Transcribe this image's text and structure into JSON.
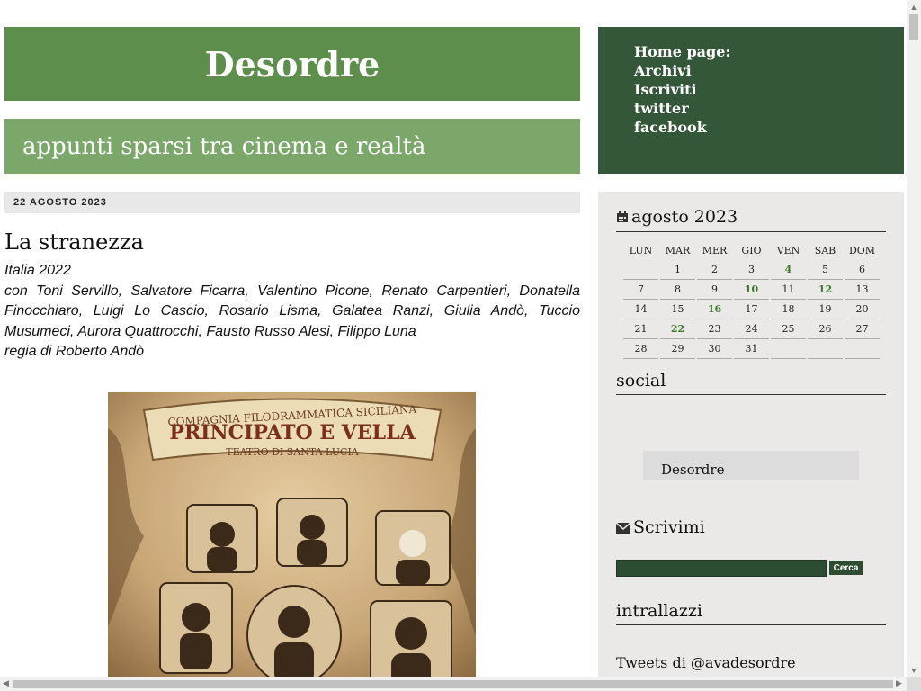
{
  "header": {
    "title": "Desordre",
    "tagline": "appunti sparsi tra cinema e realtà"
  },
  "nav": {
    "items": [
      "Home page:",
      "Archivi",
      "Iscriviti",
      "twitter",
      "facebook"
    ]
  },
  "post": {
    "date": "22 AGOSTO 2023",
    "title": "La stranezza",
    "country_year": "Italia 2022",
    "cast": "con Toni Servillo, Salvatore Ficarra, Valentino Picone, Renato Carpentieri, Donatella Finocchiaro, Luigi Lo Cascio, Rosario Lisma, Galatea Ranzi, Giulia Andò, Tuccio Musumeci, Aurora Quattrocchi, Fausto Russo Alesi, Filippo Luna",
    "director": "regia di Roberto Andò",
    "poster": {
      "line1": "COMPAGNIA FILODRAMMATICA SICILIANA",
      "line2": "PRINCIPATO E VELLA",
      "line3": "TEATRO DI SANTA LUCIA"
    }
  },
  "sidebar": {
    "calendar": {
      "title": "agosto 2023",
      "weekdays": [
        "LUN",
        "MAR",
        "MER",
        "GIO",
        "VEN",
        "SAB",
        "DOM"
      ],
      "weeks": [
        [
          "",
          "1",
          "2",
          "3",
          "4",
          "5",
          "6"
        ],
        [
          "7",
          "8",
          "9",
          "10",
          "11",
          "12",
          "13"
        ],
        [
          "14",
          "15",
          "16",
          "17",
          "18",
          "19",
          "20"
        ],
        [
          "21",
          "22",
          "23",
          "24",
          "25",
          "26",
          "27"
        ],
        [
          "28",
          "29",
          "30",
          "31",
          "",
          "",
          ""
        ]
      ],
      "linked_days": [
        "4",
        "10",
        "12",
        "16",
        "22"
      ]
    },
    "social": {
      "title": "social",
      "card_name": "Desordre"
    },
    "contact": {
      "title": "Scrivimi",
      "search_button": "Cerca"
    },
    "intrallazzi": {
      "title": "intrallazzi",
      "tweets_link": "Tweets di @avadesordre"
    }
  },
  "colors": {
    "header_green": "#5d8e4b",
    "tagline_green": "#7ba86a",
    "nav_dark_green": "#345639",
    "link_green": "#3e7a2c",
    "sidebar_bg": "#ebe9e7"
  }
}
